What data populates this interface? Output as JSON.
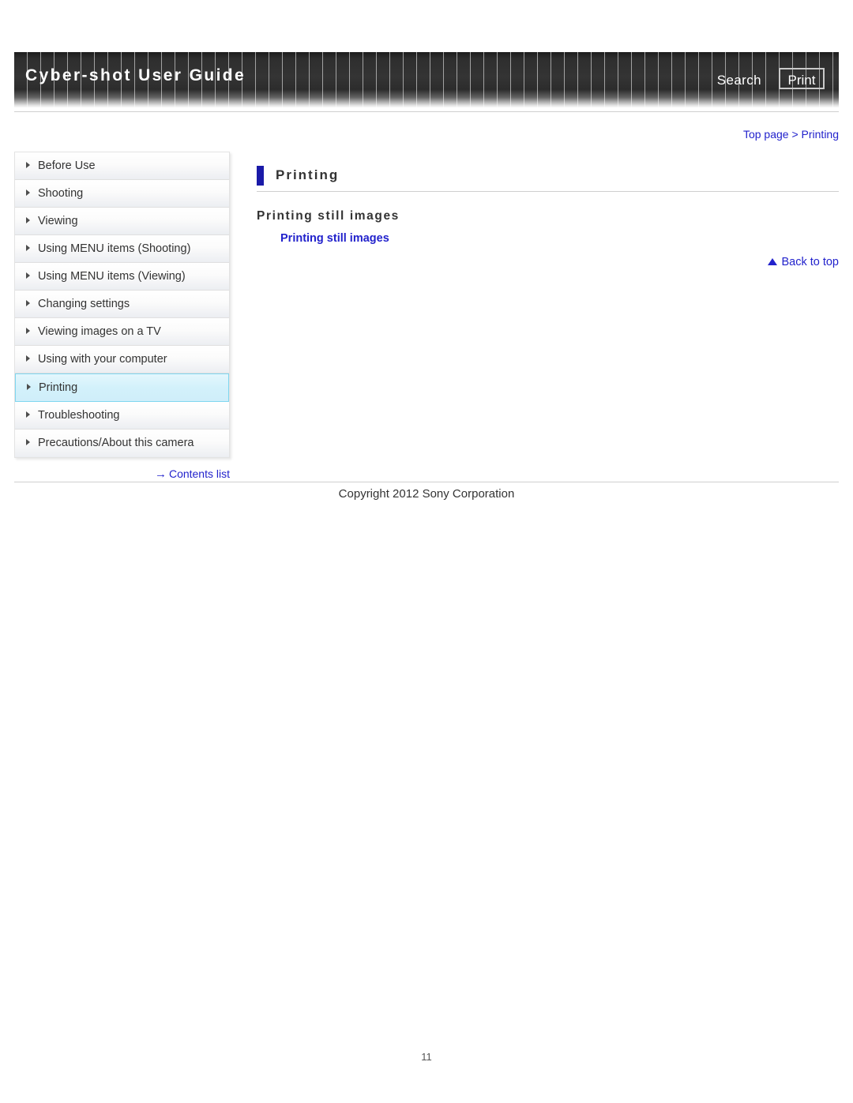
{
  "header": {
    "title": "Cyber-shot User Guide",
    "search_label": "Search",
    "print_label": "Print"
  },
  "breadcrumb": {
    "text": "Top page > Printing"
  },
  "sidebar": {
    "items": [
      {
        "label": "Before Use",
        "active": false
      },
      {
        "label": "Shooting",
        "active": false
      },
      {
        "label": "Viewing",
        "active": false
      },
      {
        "label": "Using MENU items (Shooting)",
        "active": false
      },
      {
        "label": "Using MENU items (Viewing)",
        "active": false
      },
      {
        "label": "Changing settings",
        "active": false
      },
      {
        "label": "Viewing images on a TV",
        "active": false
      },
      {
        "label": "Using with your computer",
        "active": false
      },
      {
        "label": "Printing",
        "active": true
      },
      {
        "label": "Troubleshooting",
        "active": false
      },
      {
        "label": "Precautions/About this camera",
        "active": false
      }
    ],
    "contents_link": "Contents list",
    "contents_arrow": "→"
  },
  "main": {
    "page_title": "Printing",
    "section_heading": "Printing still images",
    "section_link": "Printing still images",
    "back_to_top": "Back to top"
  },
  "footer": {
    "copyright": "Copyright 2012 Sony Corporation",
    "page_number": "11"
  },
  "colors": {
    "link": "#2222cc",
    "title_bar": "#1a1aa8",
    "active_border": "#7fd6ef",
    "active_bg": "#d3f1fb",
    "banner_dark": "#2e2e2e"
  }
}
